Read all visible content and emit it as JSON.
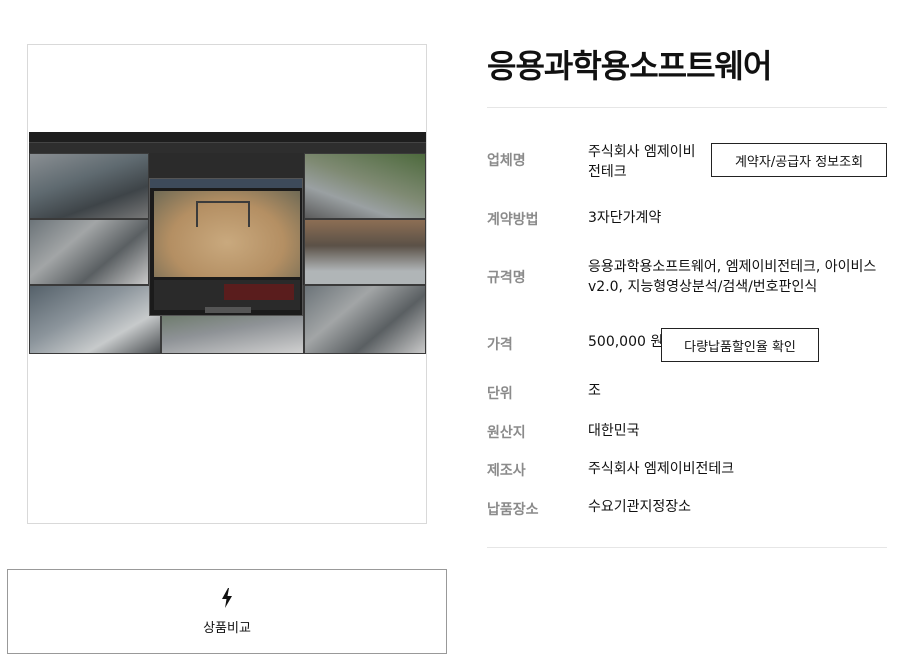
{
  "product": {
    "title": "응용과학용소프트웨어"
  },
  "details": [
    {
      "key": "company",
      "label": "업체명",
      "value": "주식회사 엠제이비\n전테크"
    },
    {
      "key": "contract",
      "label": "계약방법",
      "value": "3자단가계약"
    },
    {
      "key": "spec",
      "label": "규격명",
      "value": "응용과학용소프트웨어, 엠제이비전테크, 아이비스 v2.0, 지능형영상분석/검색/번호판인식"
    },
    {
      "key": "price",
      "label": "가격",
      "value": "500,000 원"
    },
    {
      "key": "unit",
      "label": "단위",
      "value": "조"
    },
    {
      "key": "origin",
      "label": "원산지",
      "value": "대한민국"
    },
    {
      "key": "maker",
      "label": "제조사",
      "value": "주식회사 엠제이비전테크"
    },
    {
      "key": "delivery",
      "label": "납품장소",
      "value": "수요기관지정장소"
    }
  ],
  "buttons": {
    "supplier_info": "계약자/공급자 정보조회",
    "bulk_discount": "다량납품할인율 확인",
    "compare": "상품비교"
  },
  "icons": {
    "compare": "lightning-icon"
  },
  "colors": {
    "label": "#8b8b8b",
    "title": "#111111",
    "border": "#222222"
  }
}
